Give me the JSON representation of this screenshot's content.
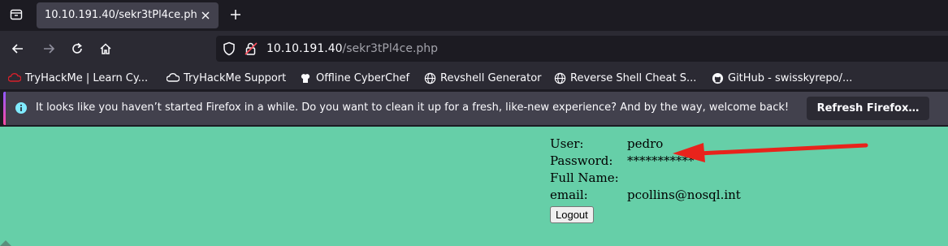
{
  "browser": {
    "tab": {
      "title": "10.10.191.40/sekr3tPl4ce.php"
    },
    "url": {
      "host": "10.10.191.40",
      "path": "/sekr3tPl4ce.php"
    },
    "bookmarks": [
      {
        "label": "TryHackMe | Learn Cy...",
        "icon": "tryhackme-icon"
      },
      {
        "label": "TryHackMe Support",
        "icon": "cloud-icon"
      },
      {
        "label": "Offline CyberChef",
        "icon": "chef-icon"
      },
      {
        "label": "Revshell Generator",
        "icon": "globe-icon"
      },
      {
        "label": "Reverse Shell Cheat S...",
        "icon": "globe-icon"
      },
      {
        "label": "GitHub - swisskyrepo/...",
        "icon": "github-icon"
      }
    ],
    "notification": {
      "text": "It looks like you haven’t started Firefox in a while. Do you want to clean it up for a fresh, like-new experience? And by the way, welcome back!",
      "button": "Refresh Firefox…"
    }
  },
  "page": {
    "user": {
      "label": "User:",
      "value": "pedro"
    },
    "password": {
      "label": "Password:",
      "value": "***********"
    },
    "fullname": {
      "label": "Full Name:",
      "value": ""
    },
    "email": {
      "label": "email:",
      "value": "pcollins@nosql.int"
    },
    "logout": "Logout"
  },
  "colors": {
    "page_background": "#66cfa8",
    "annotation_arrow": "#e8231c"
  }
}
